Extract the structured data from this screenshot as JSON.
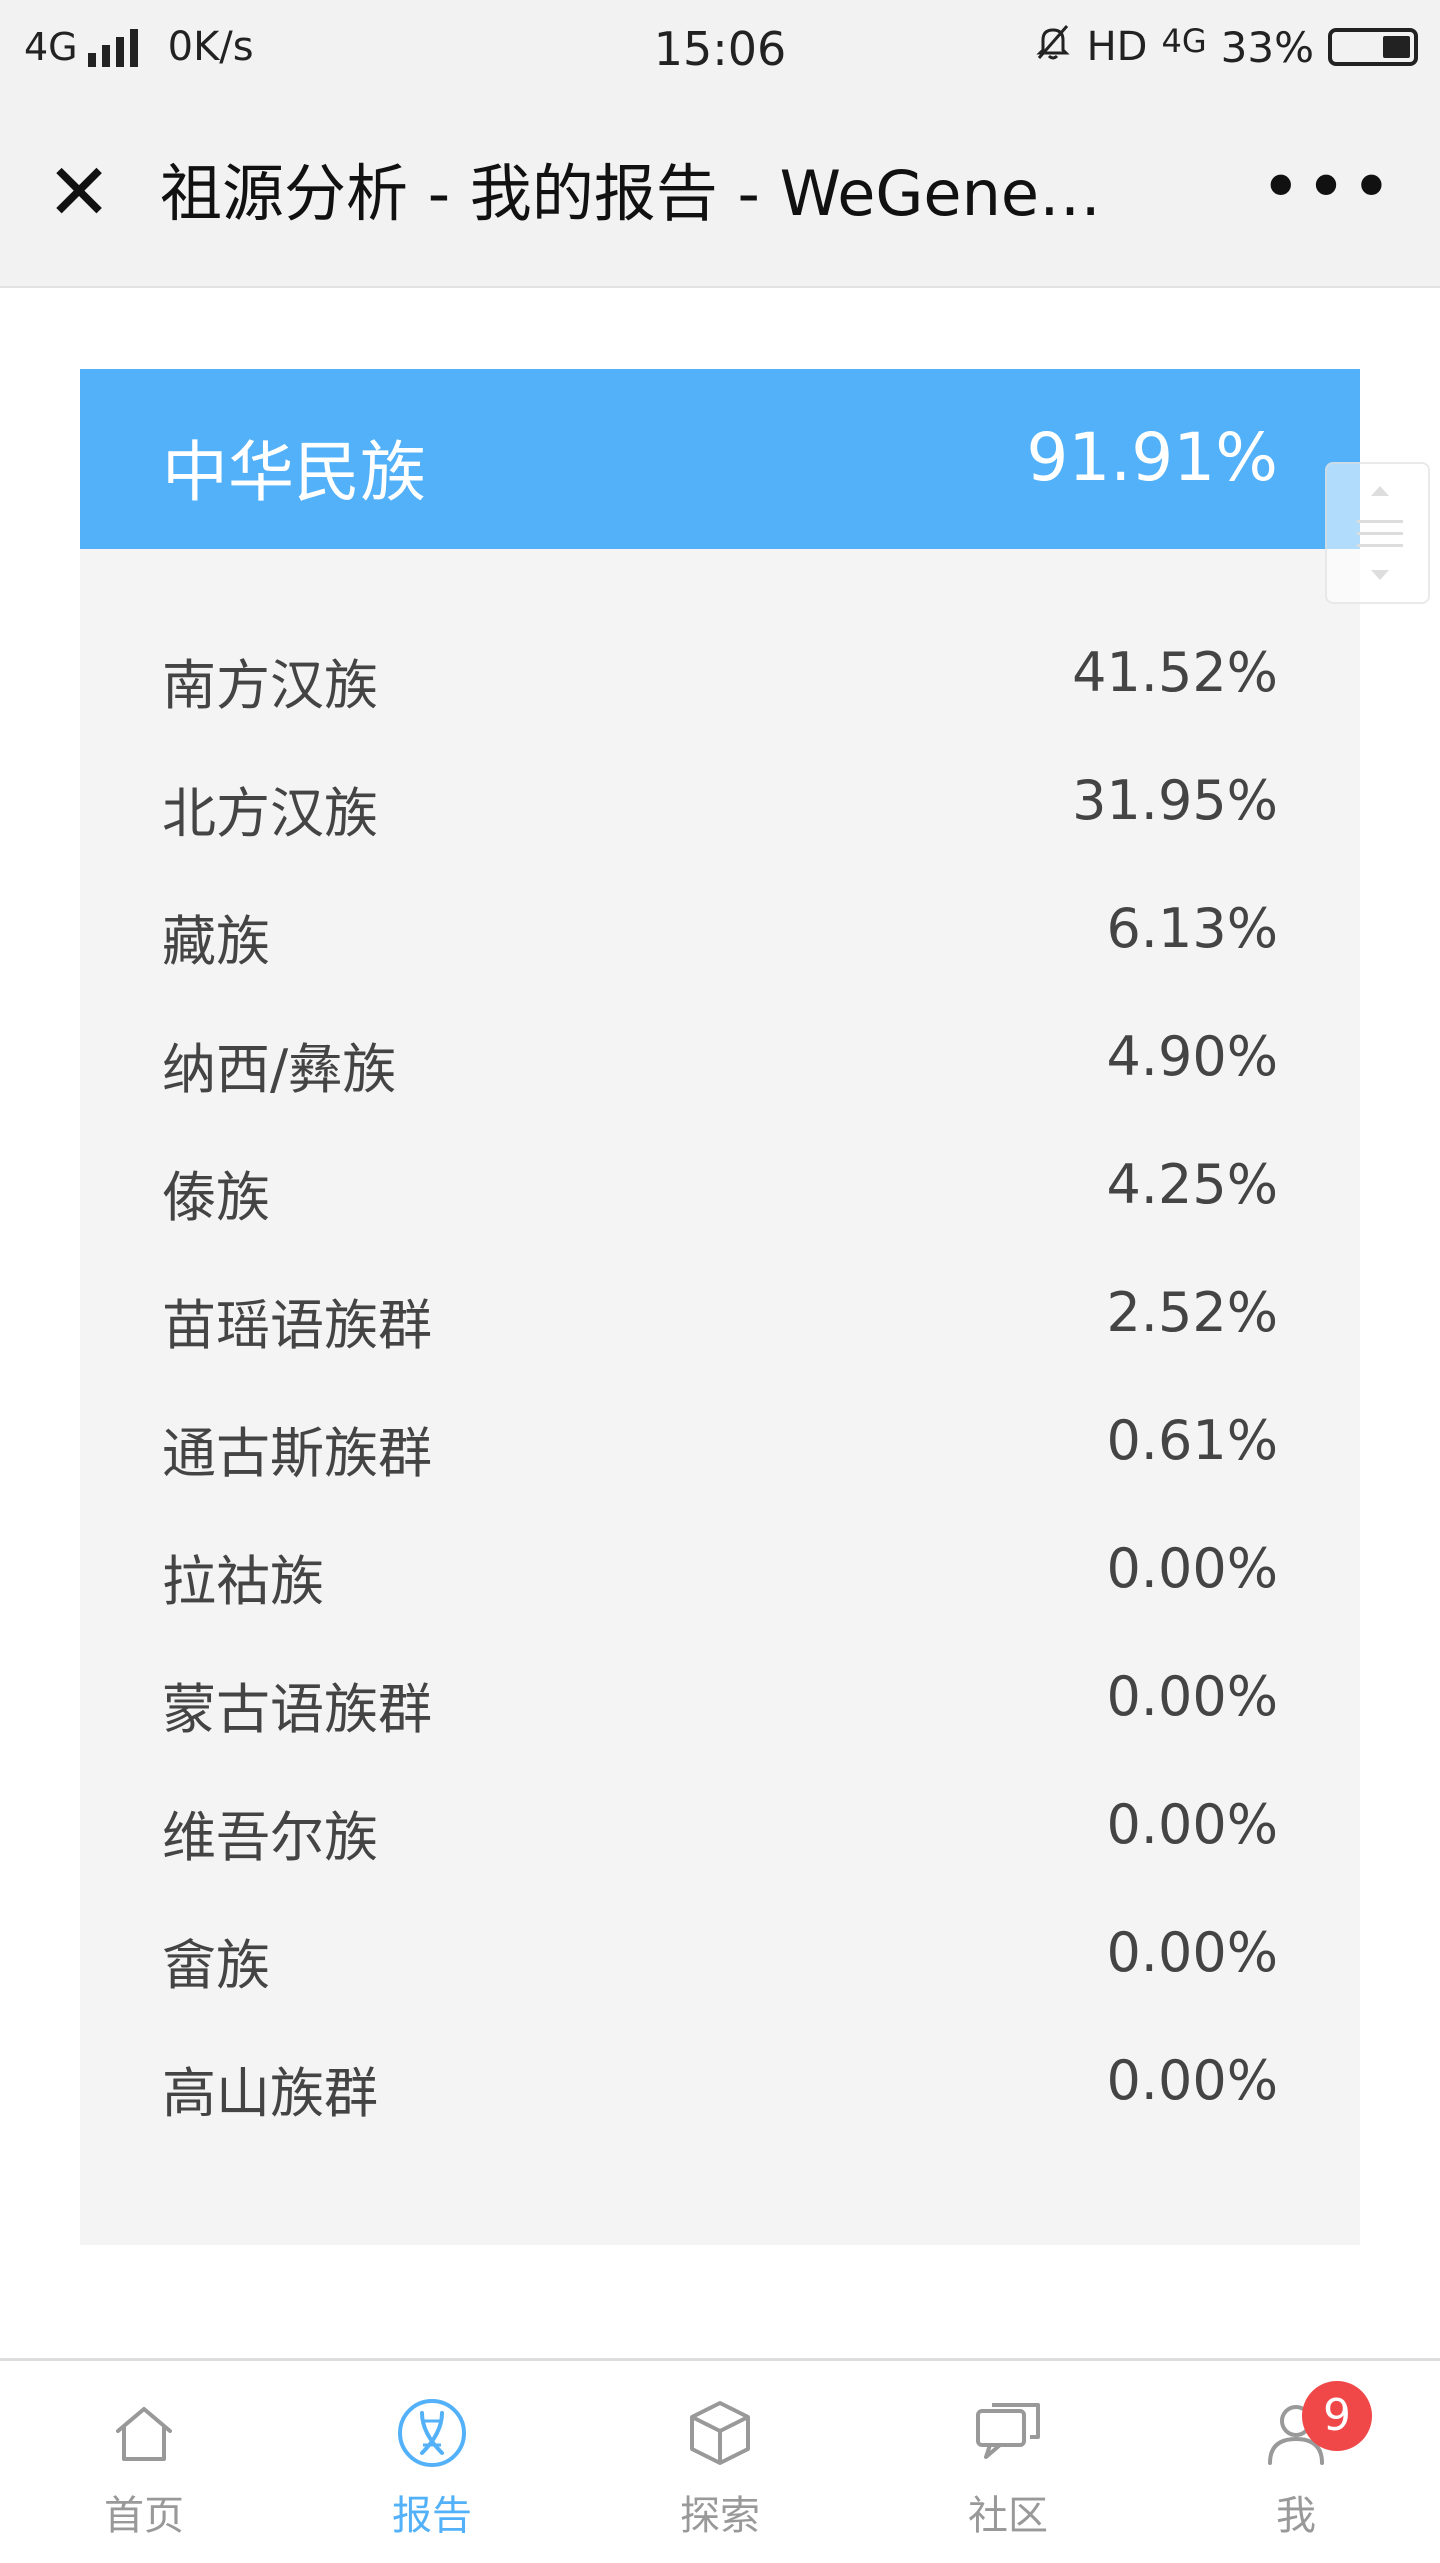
{
  "status_bar": {
    "network": "4G",
    "speed": "0K/s",
    "time": "15:06",
    "hd": "HD",
    "network_right": "4G",
    "battery": "33%",
    "battery_level": 0.33
  },
  "nav": {
    "title": "祖源分析 - 我的报告 - WeGene…"
  },
  "summary": {
    "label": "中华民族",
    "value": "91.91%"
  },
  "groups": [
    {
      "label": "南方汉族",
      "value": "41.52%"
    },
    {
      "label": "北方汉族",
      "value": "31.95%"
    },
    {
      "label": "藏族",
      "value": "6.13%"
    },
    {
      "label": "纳西/彝族",
      "value": "4.90%"
    },
    {
      "label": "傣族",
      "value": "4.25%"
    },
    {
      "label": "苗瑶语族群",
      "value": "2.52%"
    },
    {
      "label": "通古斯族群",
      "value": "0.61%"
    },
    {
      "label": "拉祜族",
      "value": "0.00%"
    },
    {
      "label": "蒙古语族群",
      "value": "0.00%"
    },
    {
      "label": "维吾尔族",
      "value": "0.00%"
    },
    {
      "label": "畲族",
      "value": "0.00%"
    },
    {
      "label": "高山族群",
      "value": "0.00%"
    }
  ],
  "tabs": [
    {
      "label": "首页",
      "icon": "home-icon",
      "active": false
    },
    {
      "label": "报告",
      "icon": "dna-icon",
      "active": true
    },
    {
      "label": "探索",
      "icon": "cube-icon",
      "active": false
    },
    {
      "label": "社区",
      "icon": "chat-icon",
      "active": false
    },
    {
      "label": "我",
      "icon": "user-icon",
      "active": false,
      "badge": "9"
    }
  ],
  "colors": {
    "accent": "#52b1f8",
    "badge": "#f04848"
  }
}
